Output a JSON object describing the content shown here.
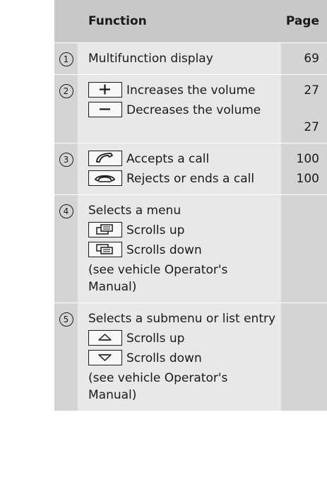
{
  "table": {
    "header": {
      "function": "Function",
      "page": "Page"
    },
    "rows": [
      {
        "num": "1",
        "items": [
          {
            "text": "Multifunction display",
            "icon": null,
            "page": "69"
          }
        ]
      },
      {
        "num": "2",
        "items": [
          {
            "text": "Increases the volume",
            "icon": "plus-key-icon",
            "page": "27"
          },
          {
            "text": "Decreases the volume",
            "icon": "minus-key-icon",
            "page": "27"
          }
        ]
      },
      {
        "num": "3",
        "items": [
          {
            "text": "Accepts a call",
            "icon": "phone-accept-icon",
            "page": "100"
          },
          {
            "text": "Rejects or ends a call",
            "icon": "phone-end-icon",
            "page": "100"
          }
        ]
      },
      {
        "num": "4",
        "items": [
          {
            "text": "Selects a menu",
            "icon": null
          },
          {
            "text": "Scrolls up",
            "icon": "menu-scroll-up-icon"
          },
          {
            "text": "Scrolls down",
            "icon": "menu-scroll-down-icon"
          },
          {
            "text": "(see vehicle Operator's Manual)",
            "icon": null
          }
        ]
      },
      {
        "num": "5",
        "items": [
          {
            "text": "Selects a submenu or list entry",
            "icon": null
          },
          {
            "text": "Scrolls up",
            "icon": "arrow-up-key-icon"
          },
          {
            "text": "Scrolls down",
            "icon": "arrow-down-key-icon"
          },
          {
            "text": "(see vehicle Operator's Manual)",
            "icon": null
          }
        ]
      }
    ]
  },
  "colors": {
    "header_bg": "#c8c8c8",
    "row_bg": "#e8e8e8",
    "side_col_bg": "#d4d4d4"
  }
}
